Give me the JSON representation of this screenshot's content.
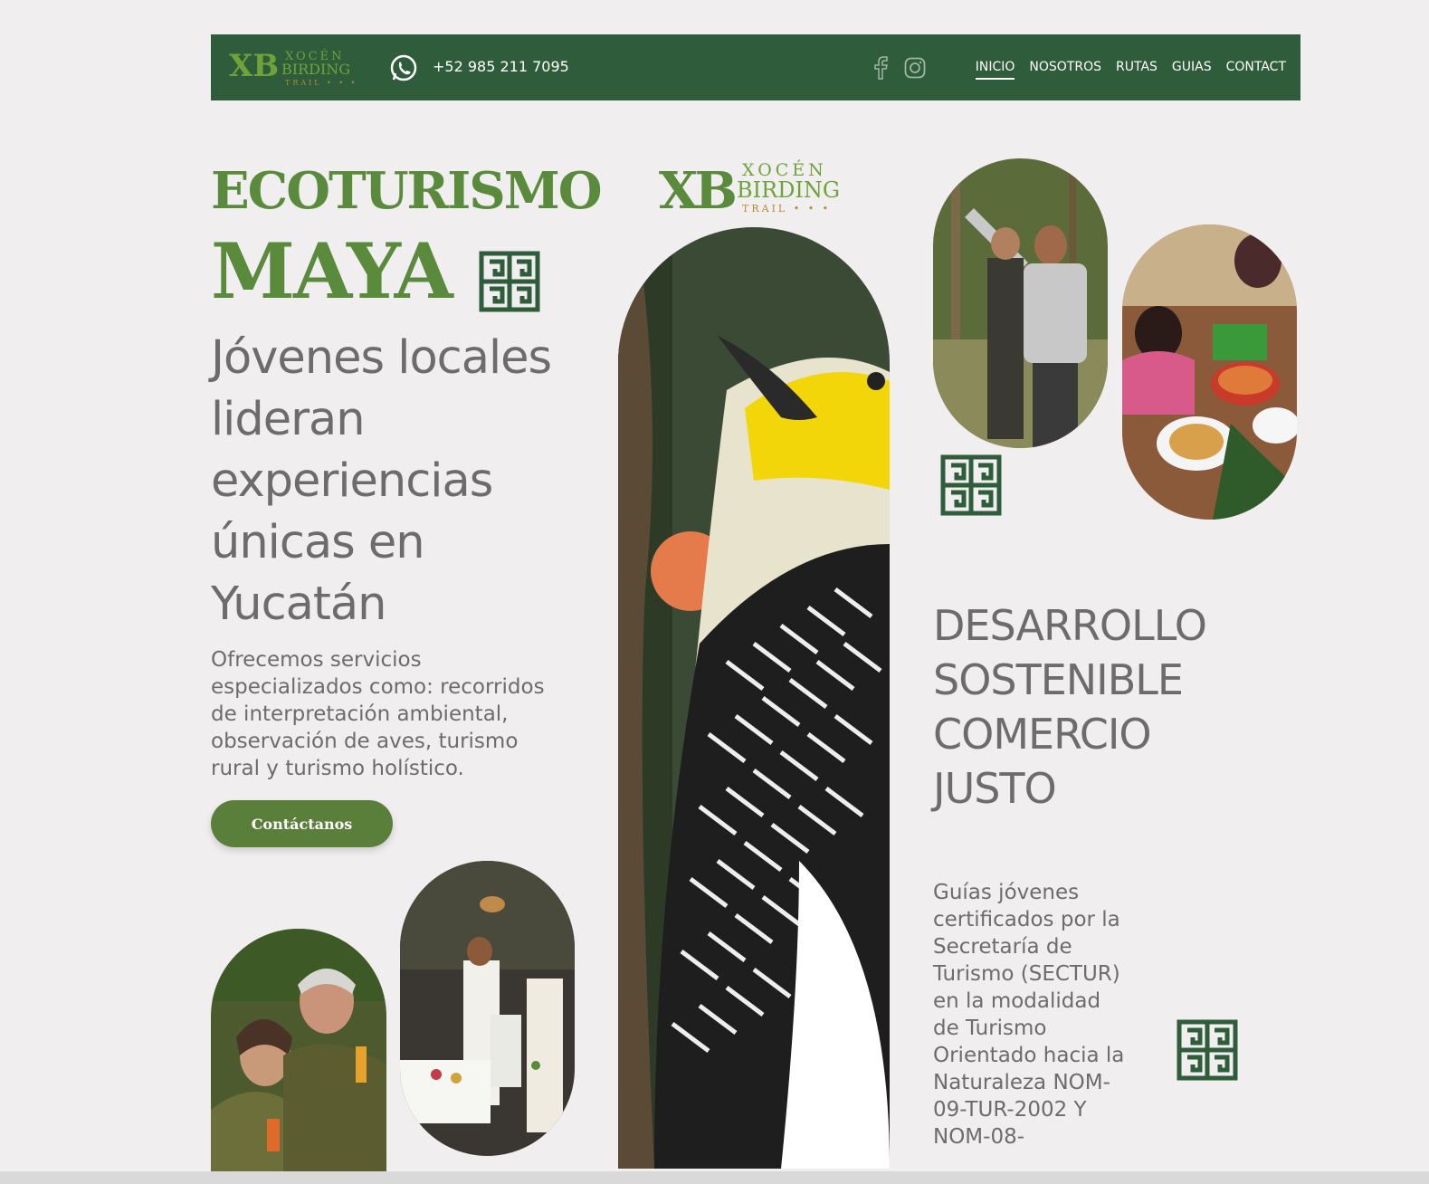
{
  "header": {
    "logo_text": "XOCÉN BIRDING TRAIL",
    "phone": "+52 985 211 7095",
    "nav": [
      "INICIO",
      "NOSOTROS",
      "RUTAS",
      "GUIAS",
      "CONTACT"
    ],
    "active_nav": "INICIO"
  },
  "hero": {
    "title_line1": "ECOTURISMO",
    "title_line2": "MAYA",
    "subtitle": "Jóvenes locales lideran experiencias únicas en Yucatán",
    "description": "Ofrecemos servicios especializados como:  recorridos de interpretación ambiental, observación de aves, turismo rural y turismo holístico.",
    "cta": "Contáctanos"
  },
  "right": {
    "title": "DESARROLLO SOSTENIBLE COMERCIO JUSTO",
    "description": "Guías jóvenes certificados por la Secretaría de Turismo (SECTUR) en la modalidad de Turismo Orientado hacia la Naturaleza NOM-09-TUR-2002 Y NOM-08-"
  },
  "colors": {
    "header_bg": "#2f5c3a",
    "brand_green": "#5a8a3b",
    "text_gray": "#6e6b6c",
    "page_bg": "#f0eeef"
  }
}
